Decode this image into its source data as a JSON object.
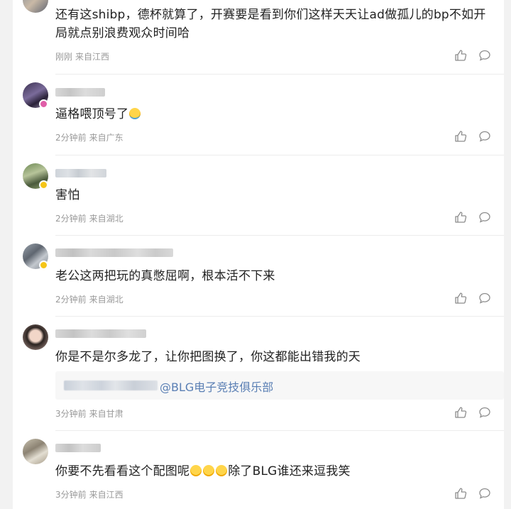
{
  "comments": [
    {
      "text": "还有这shibp，德杯就算了，开赛要是看到你们这样天天让ad做孤儿的bp不如开局就点别浪费观众时间哈",
      "time": "刚刚",
      "location": "来自江西"
    },
    {
      "text": "逼格喂顶号了",
      "emoji": "crying-face-emoji",
      "time": "2分钟前",
      "location": "来自广东",
      "avatar_badge_color": "#e05ea8"
    },
    {
      "text": "害怕",
      "time": "2分钟前",
      "location": "来自湖北",
      "avatar_badge_color": "#f5c518"
    },
    {
      "text": "老公这两把玩的真憋屈啊，根本活不下来",
      "time": "2分钟前",
      "location": "来自湖北",
      "avatar_badge_color": "#f5c518"
    },
    {
      "text": "你是不是尔多龙了，让你把图换了，你这都能出错我的天",
      "quote_mention": "@BLG电子竞技俱乐部",
      "time": "3分钟前",
      "location": "来自甘肃"
    },
    {
      "text_before": "你要不先看看这个配图呢",
      "emoji": "laughing-face-emoji",
      "text_after": "除了BLG谁还来逗我笑",
      "time": "3分钟前",
      "location": "来自江西"
    }
  ],
  "icons": {
    "like": "thumbs-up-icon",
    "reply": "comment-bubble-icon"
  },
  "colors": {
    "text": "#222222",
    "meta": "#999999",
    "mention": "#5a7fb4"
  }
}
